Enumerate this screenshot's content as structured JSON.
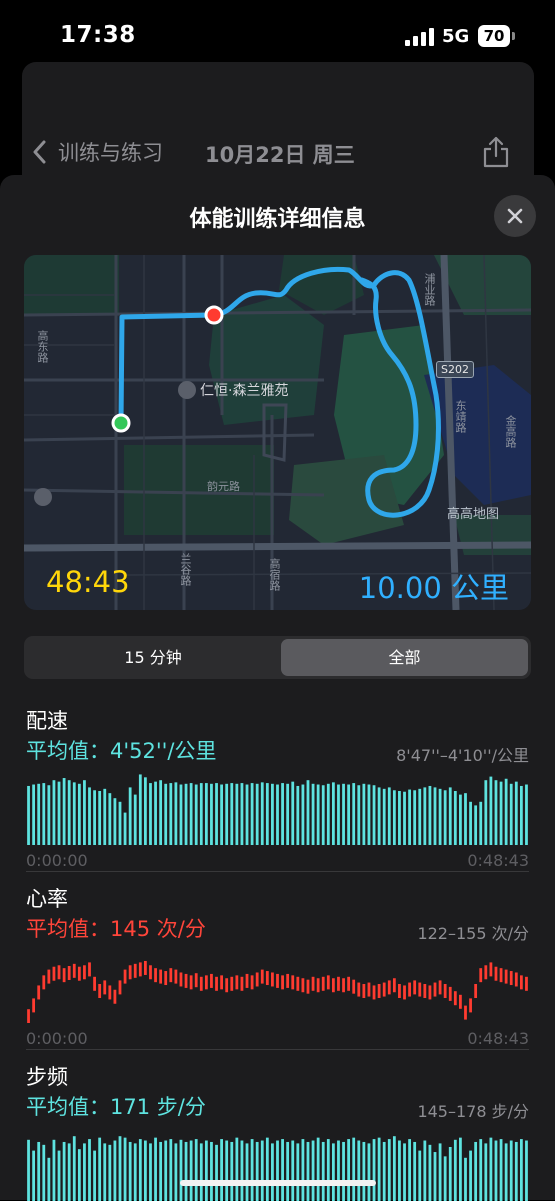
{
  "status_bar": {
    "time": "17:38",
    "network": "5G",
    "battery": "70"
  },
  "background_sheet": {
    "back_label": "训练与练习",
    "date": "10月22日 周三"
  },
  "modal": {
    "title": "体能训练详细信息"
  },
  "map": {
    "duration": "48:43",
    "distance": "10.00 公里",
    "poi": "仁恒·森兰雅苑",
    "road_labels": {
      "vertical_left": "高东路",
      "middle": "韵元路",
      "bottom_a": "兰谷路",
      "bottom_b": "高宿路",
      "right_a": "浦业路",
      "right_b": "东靖路",
      "far_right": "金高路",
      "shield": "S202"
    },
    "area_label": "高高地图"
  },
  "segmented": {
    "options": [
      "15 分钟",
      "全部"
    ],
    "selected": "全部"
  },
  "metrics": {
    "pace": {
      "name": "配速",
      "avg": "平均值：4'52''/公里",
      "range": "8'47''–4'10''/公里",
      "start": "0:00:00",
      "end": "0:48:43",
      "color": "#5ee3e0"
    },
    "heart": {
      "name": "心率",
      "avg": "平均值：145 次/分",
      "range": "122–155 次/分",
      "start": "0:00:00",
      "end": "0:48:43",
      "color": "#ff3b30"
    },
    "cadence": {
      "name": "步频",
      "avg": "平均值：171 步/分",
      "range": "145–178 步/分",
      "color": "#5ee3e0"
    }
  },
  "chart_data": [
    {
      "type": "bar",
      "title": "配速",
      "values": [
        0.82,
        0.84,
        0.85,
        0.86,
        0.83,
        0.9,
        0.88,
        0.93,
        0.9,
        0.87,
        0.85,
        0.9,
        0.8,
        0.76,
        0.75,
        0.78,
        0.72,
        0.65,
        0.6,
        0.45,
        0.8,
        0.7,
        0.98,
        0.94,
        0.86,
        0.88,
        0.9,
        0.85,
        0.86,
        0.87,
        0.84,
        0.85,
        0.86,
        0.84,
        0.86,
        0.86,
        0.85,
        0.86,
        0.84,
        0.85,
        0.86,
        0.85,
        0.86,
        0.84,
        0.86,
        0.85,
        0.87,
        0.86,
        0.85,
        0.84,
        0.86,
        0.85,
        0.88,
        0.82,
        0.84,
        0.9,
        0.85,
        0.84,
        0.83,
        0.85,
        0.87,
        0.84,
        0.85,
        0.84,
        0.86,
        0.83,
        0.85,
        0.84,
        0.83,
        0.8,
        0.78,
        0.8,
        0.76,
        0.75,
        0.74,
        0.77,
        0.76,
        0.78,
        0.8,
        0.82,
        0.8,
        0.78,
        0.76,
        0.8,
        0.75,
        0.7,
        0.72,
        0.6,
        0.55,
        0.6,
        0.9,
        0.95,
        0.9,
        0.88,
        0.92,
        0.85,
        0.88,
        0.82,
        0.84
      ],
      "y_label_range": "8'47''–4'10''/公里"
    },
    {
      "type": "bar",
      "title": "心率",
      "values": [
        0.15,
        0.3,
        0.48,
        0.62,
        0.7,
        0.74,
        0.76,
        0.72,
        0.75,
        0.78,
        0.74,
        0.76,
        0.8,
        0.6,
        0.5,
        0.55,
        0.48,
        0.42,
        0.55,
        0.7,
        0.76,
        0.78,
        0.8,
        0.82,
        0.76,
        0.72,
        0.7,
        0.68,
        0.72,
        0.7,
        0.66,
        0.64,
        0.62,
        0.65,
        0.6,
        0.62,
        0.64,
        0.6,
        0.62,
        0.58,
        0.6,
        0.62,
        0.6,
        0.64,
        0.62,
        0.66,
        0.7,
        0.68,
        0.66,
        0.64,
        0.62,
        0.64,
        0.62,
        0.6,
        0.58,
        0.56,
        0.6,
        0.58,
        0.6,
        0.62,
        0.58,
        0.6,
        0.58,
        0.6,
        0.56,
        0.52,
        0.5,
        0.52,
        0.48,
        0.5,
        0.52,
        0.55,
        0.58,
        0.5,
        0.48,
        0.52,
        0.55,
        0.52,
        0.5,
        0.48,
        0.52,
        0.55,
        0.5,
        0.46,
        0.4,
        0.35,
        0.2,
        0.3,
        0.5,
        0.72,
        0.76,
        0.8,
        0.74,
        0.72,
        0.7,
        0.68,
        0.66,
        0.62,
        0.6
      ],
      "y_label_range": "122–155 次/分"
    },
    {
      "type": "bar",
      "title": "步频",
      "values": [
        0.85,
        0.7,
        0.82,
        0.78,
        0.6,
        0.85,
        0.7,
        0.82,
        0.8,
        0.9,
        0.72,
        0.8,
        0.86,
        0.7,
        0.88,
        0.8,
        0.78,
        0.84,
        0.9,
        0.88,
        0.82,
        0.8,
        0.86,
        0.84,
        0.8,
        0.88,
        0.82,
        0.84,
        0.86,
        0.8,
        0.85,
        0.82,
        0.84,
        0.86,
        0.8,
        0.84,
        0.82,
        0.78,
        0.86,
        0.84,
        0.82,
        0.88,
        0.84,
        0.8,
        0.86,
        0.82,
        0.84,
        0.88,
        0.8,
        0.84,
        0.86,
        0.82,
        0.84,
        0.8,
        0.86,
        0.82,
        0.84,
        0.88,
        0.82,
        0.86,
        0.8,
        0.84,
        0.82,
        0.86,
        0.88,
        0.84,
        0.82,
        0.8,
        0.86,
        0.88,
        0.82,
        0.86,
        0.9,
        0.84,
        0.8,
        0.86,
        0.82,
        0.7,
        0.84,
        0.78,
        0.68,
        0.8,
        0.62,
        0.75,
        0.85,
        0.88,
        0.6,
        0.7,
        0.82,
        0.86,
        0.8,
        0.88,
        0.84,
        0.86,
        0.8,
        0.84,
        0.82,
        0.86,
        0.84
      ],
      "y_label_range": "145–178 步/分"
    }
  ]
}
